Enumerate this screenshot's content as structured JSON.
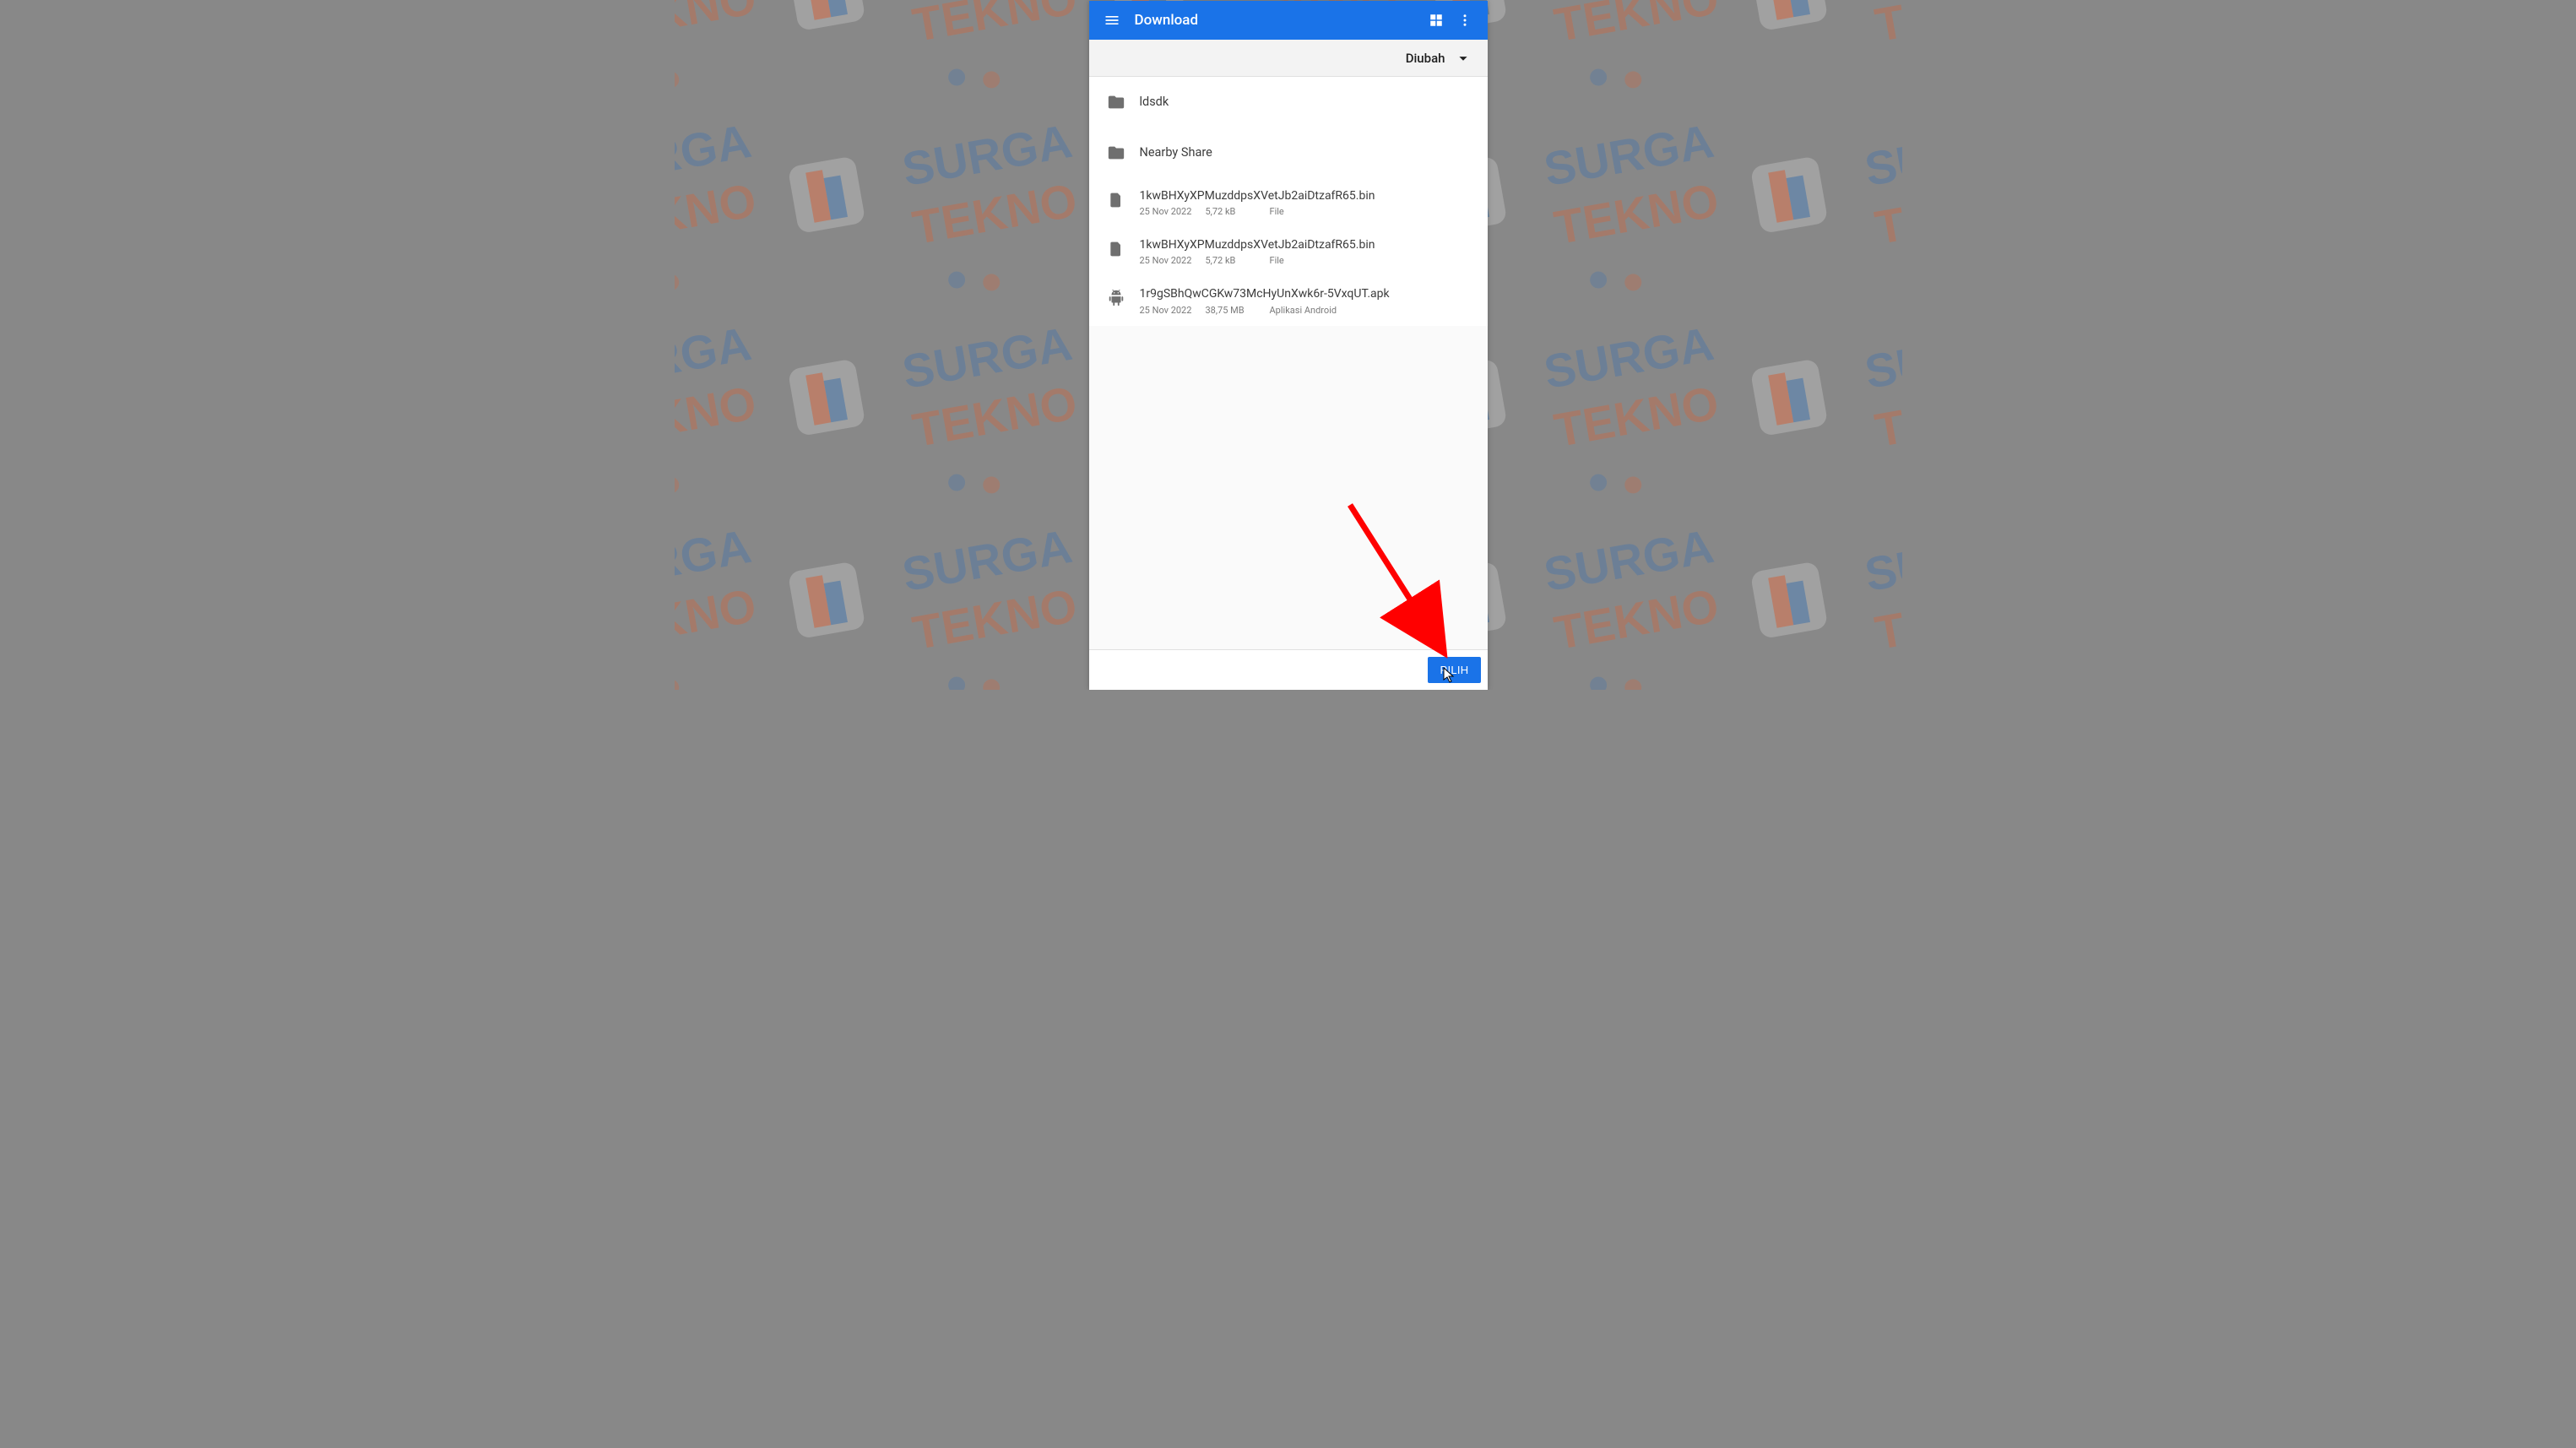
{
  "appbar": {
    "title": "Download"
  },
  "sortbar": {
    "label": "Diubah"
  },
  "items": [
    {
      "kind": "folder",
      "name": "ldsdk"
    },
    {
      "kind": "folder",
      "name": "Nearby Share"
    },
    {
      "kind": "file",
      "name": "1kwBHXyXPMuzddpsXVetJb2aiDtzafR65.bin",
      "date": "25 Nov 2022",
      "size": "5,72 kB",
      "type": "File"
    },
    {
      "kind": "file",
      "name": "1kwBHXyXPMuzddpsXVetJb2aiDtzafR65.bin",
      "date": "25 Nov 2022",
      "size": "5,72 kB",
      "type": "File"
    },
    {
      "kind": "apk",
      "name": "1r9gSBhQwCGKw73McHyUnXwk6r-5VxqUT.apk",
      "date": "25 Nov 2022",
      "size": "38,75 MB",
      "type": "Aplikasi Android"
    }
  ],
  "bottombar": {
    "select": "PILIH"
  },
  "colors": {
    "primary": "#1a73e8",
    "annotation": "#ff0000"
  }
}
